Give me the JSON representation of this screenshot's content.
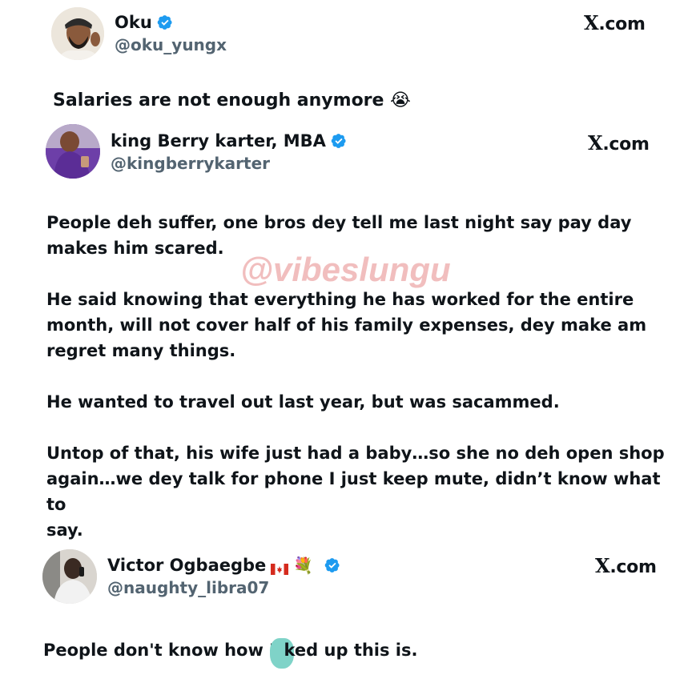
{
  "tweets": [
    {
      "name": "Oku",
      "handle": "@oku_yungx",
      "source": "X.com",
      "text": "Salaries are not enough anymore",
      "emoji": "😭",
      "colors": {
        "avatar_bg": "#e9e2d8",
        "avatar_fg": "#3b2f28"
      }
    },
    {
      "name": "king Berry karter, MBA",
      "handle": "@kingberrykarter",
      "source": "X.com",
      "paragraphs": [
        "People deh suffer, one bros dey tell me last night say pay day\nmakes him scared.",
        "He said knowing that everything he has worked for the entire\nmonth, will not cover half of his family expenses, dey make am\nregret many things.",
        "He wanted to travel out last year,  but was sacammed.",
        "Untop of that, his wife just had a baby…so she no deh open shop\nagain…we dey talk for phone I just keep mute, didn’t know what to\nsay."
      ],
      "colors": {
        "avatar_bg": "#6d3fa8",
        "avatar_fg": "#c79a7a"
      }
    },
    {
      "name": "Victor Ogbaegbe",
      "name_emoji": "💐",
      "handle": "@naughty_libra07",
      "source": "X.com",
      "text_before": "People don't know how F",
      "text_after": "ked up this is.",
      "colors": {
        "avatar_bg": "#d9d5cf",
        "avatar_fg": "#2a2320",
        "censor": "#7fd3c8"
      }
    }
  ],
  "watermark": "@vibeslungu",
  "colors": {
    "verified": "#1d9bf0",
    "handle": "#536471",
    "text": "#0f1419",
    "watermark": "#e89696"
  },
  "icons": [
    "verified-badge-icon",
    "x-logo-icon",
    "canada-flag-icon"
  ]
}
